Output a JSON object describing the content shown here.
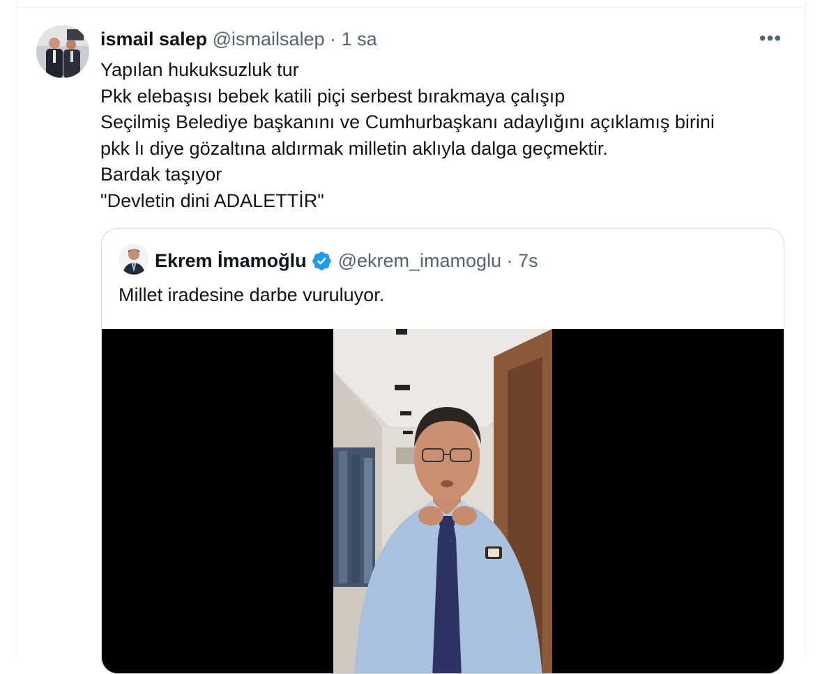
{
  "tweet": {
    "author_name": "ismail salep",
    "author_handle": "@ismailsalep",
    "separator": "·",
    "time": "1 sa",
    "more_label": "•••",
    "lines": [
      "Yapılan hukuksuzluk tur",
      "Pkk elebaşısı bebek katili piçi serbest bırakmaya çalışıp",
      "Seçilmiş Belediye başkanını ve Cumhurbaşkanı adaylığını açıklamış birini",
      "pkk lı diye gözaltına aldırmak milletin aklıyla dalga geçmektir.",
      "Bardak taşıyor",
      "\"Devletin dini ADALETTİR\""
    ]
  },
  "quote": {
    "author_name": "Ekrem İmamoğlu",
    "author_handle": "@ekrem_imamoglu",
    "separator": "·",
    "time": "7s",
    "text": "Millet iradesine darbe vuruluyor."
  },
  "colors": {
    "text_primary": "#0f1419",
    "text_secondary": "#536471",
    "verified_blue": "#1d9bf0",
    "border": "#cfd9de"
  }
}
